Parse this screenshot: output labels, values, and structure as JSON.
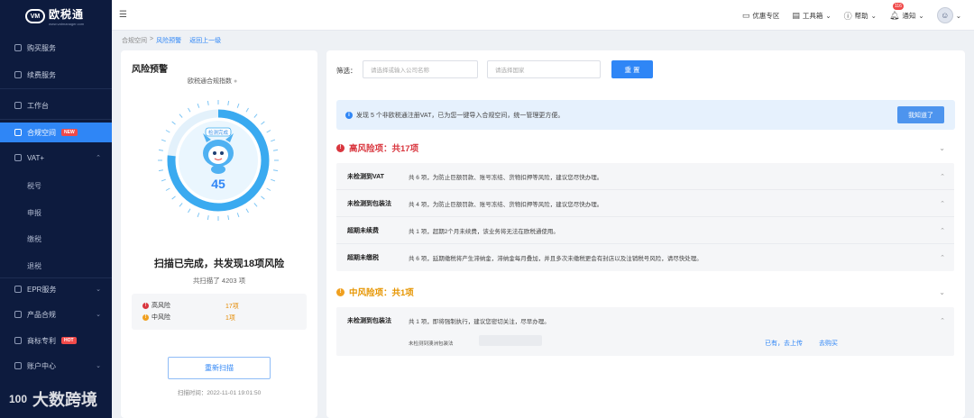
{
  "app": {
    "logo_mark": "VM",
    "logo_title": "欧税通",
    "logo_subtitle": "www.vatmanager.com"
  },
  "sidebar": {
    "items": [
      {
        "label": "购买服务"
      },
      {
        "label": "续费服务"
      },
      {
        "label": "工作台"
      },
      {
        "label": "合规空间",
        "badge": "NEW"
      },
      {
        "label": "VAT+"
      },
      {
        "label": "税号"
      },
      {
        "label": "申报"
      },
      {
        "label": "缴税"
      },
      {
        "label": "退税"
      },
      {
        "label": "EPR服务"
      },
      {
        "label": "产品合规"
      },
      {
        "label": "商标专利",
        "badge": "HOT"
      },
      {
        "label": "账户中心"
      }
    ]
  },
  "watermark": {
    "logo": "100",
    "text": "大数跨境"
  },
  "topbar": {
    "discount": "优惠专区",
    "toolbox": "工具箱",
    "help": "帮助",
    "notify": "通知",
    "notify_count": "116"
  },
  "breadcrumb": {
    "root": "合规空间",
    "sep": ">",
    "current": "风险预警",
    "back": "返回上一级"
  },
  "left": {
    "title": "风险预警",
    "subtitle": "欧税通合规指数",
    "gauge_tag": "检测完成",
    "score": "45",
    "scan_title": "扫描已完成，共发现18项风险",
    "scan_sub": "共扫描了 4203 项",
    "high_label": "高风险",
    "high_value": "17项",
    "mid_label": "中风险",
    "mid_value": "1项",
    "rescan": "重新扫描",
    "scan_time": "扫描时间：2022-11-01 19:01:50"
  },
  "filter": {
    "label": "筛选：",
    "company_placeholder": "请选择或输入公司名称",
    "country_placeholder": "请选择国家",
    "reset": "重 置"
  },
  "notice": {
    "text": "发现 5 个非欧税通注册VAT，已为您一键导入合规空间，统一管理更方便。",
    "button": "我知道了"
  },
  "high_section": {
    "title": "高风险项：共17项",
    "items": [
      {
        "name": "未检测到VAT",
        "desc": "共 6 项，为防止巨额罚款、账号冻结、货物扣押等风险，建议您尽快办理。"
      },
      {
        "name": "未检测到包装法",
        "desc": "共 4 项，为防止巨额罚款、账号冻结、货物扣押等风险，建议您尽快办理。"
      },
      {
        "name": "超期未续费",
        "desc": "共 1 项，超期2个月未续费，该业务将无法在欧税通使用。"
      },
      {
        "name": "超期未缴税",
        "desc": "共 6 项，延期缴税将产生滞纳金，滞纳金每月叠加，并且多次未缴税更会有封店以及注销税号风险，请尽快处理。"
      }
    ]
  },
  "mid_section": {
    "title": "中风险项：共1项",
    "items": [
      {
        "name": "未检测到包装法",
        "desc": "共 1 项，即将强制执行，建议您密切关注，尽早办理。",
        "sub": "未检测到澳洲包装法",
        "link1": "已有，去上传",
        "link2": "去购买"
      }
    ]
  }
}
